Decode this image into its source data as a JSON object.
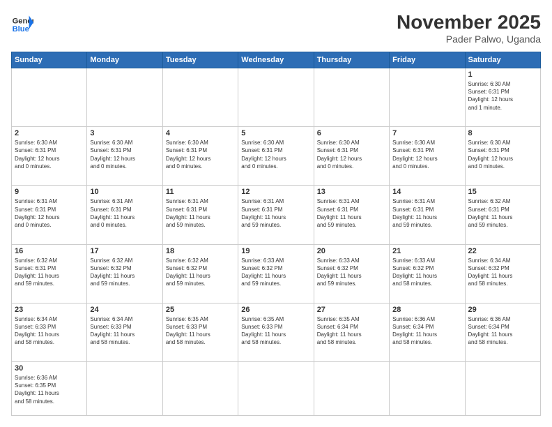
{
  "header": {
    "logo_general": "General",
    "logo_blue": "Blue",
    "title": "November 2025",
    "subtitle": "Pader Palwo, Uganda"
  },
  "days_of_week": [
    "Sunday",
    "Monday",
    "Tuesday",
    "Wednesday",
    "Thursday",
    "Friday",
    "Saturday"
  ],
  "weeks": [
    [
      {
        "day": "",
        "info": ""
      },
      {
        "day": "",
        "info": ""
      },
      {
        "day": "",
        "info": ""
      },
      {
        "day": "",
        "info": ""
      },
      {
        "day": "",
        "info": ""
      },
      {
        "day": "",
        "info": ""
      },
      {
        "day": "1",
        "info": "Sunrise: 6:30 AM\nSunset: 6:31 PM\nDaylight: 12 hours\nand 1 minute."
      }
    ],
    [
      {
        "day": "2",
        "info": "Sunrise: 6:30 AM\nSunset: 6:31 PM\nDaylight: 12 hours\nand 0 minutes."
      },
      {
        "day": "3",
        "info": "Sunrise: 6:30 AM\nSunset: 6:31 PM\nDaylight: 12 hours\nand 0 minutes."
      },
      {
        "day": "4",
        "info": "Sunrise: 6:30 AM\nSunset: 6:31 PM\nDaylight: 12 hours\nand 0 minutes."
      },
      {
        "day": "5",
        "info": "Sunrise: 6:30 AM\nSunset: 6:31 PM\nDaylight: 12 hours\nand 0 minutes."
      },
      {
        "day": "6",
        "info": "Sunrise: 6:30 AM\nSunset: 6:31 PM\nDaylight: 12 hours\nand 0 minutes."
      },
      {
        "day": "7",
        "info": "Sunrise: 6:30 AM\nSunset: 6:31 PM\nDaylight: 12 hours\nand 0 minutes."
      },
      {
        "day": "8",
        "info": "Sunrise: 6:30 AM\nSunset: 6:31 PM\nDaylight: 12 hours\nand 0 minutes."
      }
    ],
    [
      {
        "day": "9",
        "info": "Sunrise: 6:31 AM\nSunset: 6:31 PM\nDaylight: 12 hours\nand 0 minutes."
      },
      {
        "day": "10",
        "info": "Sunrise: 6:31 AM\nSunset: 6:31 PM\nDaylight: 11 hours\nand 0 minutes."
      },
      {
        "day": "11",
        "info": "Sunrise: 6:31 AM\nSunset: 6:31 PM\nDaylight: 11 hours\nand 59 minutes."
      },
      {
        "day": "12",
        "info": "Sunrise: 6:31 AM\nSunset: 6:31 PM\nDaylight: 11 hours\nand 59 minutes."
      },
      {
        "day": "13",
        "info": "Sunrise: 6:31 AM\nSunset: 6:31 PM\nDaylight: 11 hours\nand 59 minutes."
      },
      {
        "day": "14",
        "info": "Sunrise: 6:31 AM\nSunset: 6:31 PM\nDaylight: 11 hours\nand 59 minutes."
      },
      {
        "day": "15",
        "info": "Sunrise: 6:32 AM\nSunset: 6:31 PM\nDaylight: 11 hours\nand 59 minutes."
      }
    ],
    [
      {
        "day": "16",
        "info": "Sunrise: 6:32 AM\nSunset: 6:31 PM\nDaylight: 11 hours\nand 59 minutes."
      },
      {
        "day": "17",
        "info": "Sunrise: 6:32 AM\nSunset: 6:32 PM\nDaylight: 11 hours\nand 59 minutes."
      },
      {
        "day": "18",
        "info": "Sunrise: 6:32 AM\nSunset: 6:32 PM\nDaylight: 11 hours\nand 59 minutes."
      },
      {
        "day": "19",
        "info": "Sunrise: 6:33 AM\nSunset: 6:32 PM\nDaylight: 11 hours\nand 59 minutes."
      },
      {
        "day": "20",
        "info": "Sunrise: 6:33 AM\nSunset: 6:32 PM\nDaylight: 11 hours\nand 59 minutes."
      },
      {
        "day": "21",
        "info": "Sunrise: 6:33 AM\nSunset: 6:32 PM\nDaylight: 11 hours\nand 58 minutes."
      },
      {
        "day": "22",
        "info": "Sunrise: 6:34 AM\nSunset: 6:32 PM\nDaylight: 11 hours\nand 58 minutes."
      }
    ],
    [
      {
        "day": "23",
        "info": "Sunrise: 6:34 AM\nSunset: 6:33 PM\nDaylight: 11 hours\nand 58 minutes."
      },
      {
        "day": "24",
        "info": "Sunrise: 6:34 AM\nSunset: 6:33 PM\nDaylight: 11 hours\nand 58 minutes."
      },
      {
        "day": "25",
        "info": "Sunrise: 6:35 AM\nSunset: 6:33 PM\nDaylight: 11 hours\nand 58 minutes."
      },
      {
        "day": "26",
        "info": "Sunrise: 6:35 AM\nSunset: 6:33 PM\nDaylight: 11 hours\nand 58 minutes."
      },
      {
        "day": "27",
        "info": "Sunrise: 6:35 AM\nSunset: 6:34 PM\nDaylight: 11 hours\nand 58 minutes."
      },
      {
        "day": "28",
        "info": "Sunrise: 6:36 AM\nSunset: 6:34 PM\nDaylight: 11 hours\nand 58 minutes."
      },
      {
        "day": "29",
        "info": "Sunrise: 6:36 AM\nSunset: 6:34 PM\nDaylight: 11 hours\nand 58 minutes."
      }
    ],
    [
      {
        "day": "30",
        "info": "Sunrise: 6:36 AM\nSunset: 6:35 PM\nDaylight: 11 hours\nand 58 minutes."
      },
      {
        "day": "",
        "info": ""
      },
      {
        "day": "",
        "info": ""
      },
      {
        "day": "",
        "info": ""
      },
      {
        "day": "",
        "info": ""
      },
      {
        "day": "",
        "info": ""
      },
      {
        "day": "",
        "info": ""
      }
    ]
  ]
}
